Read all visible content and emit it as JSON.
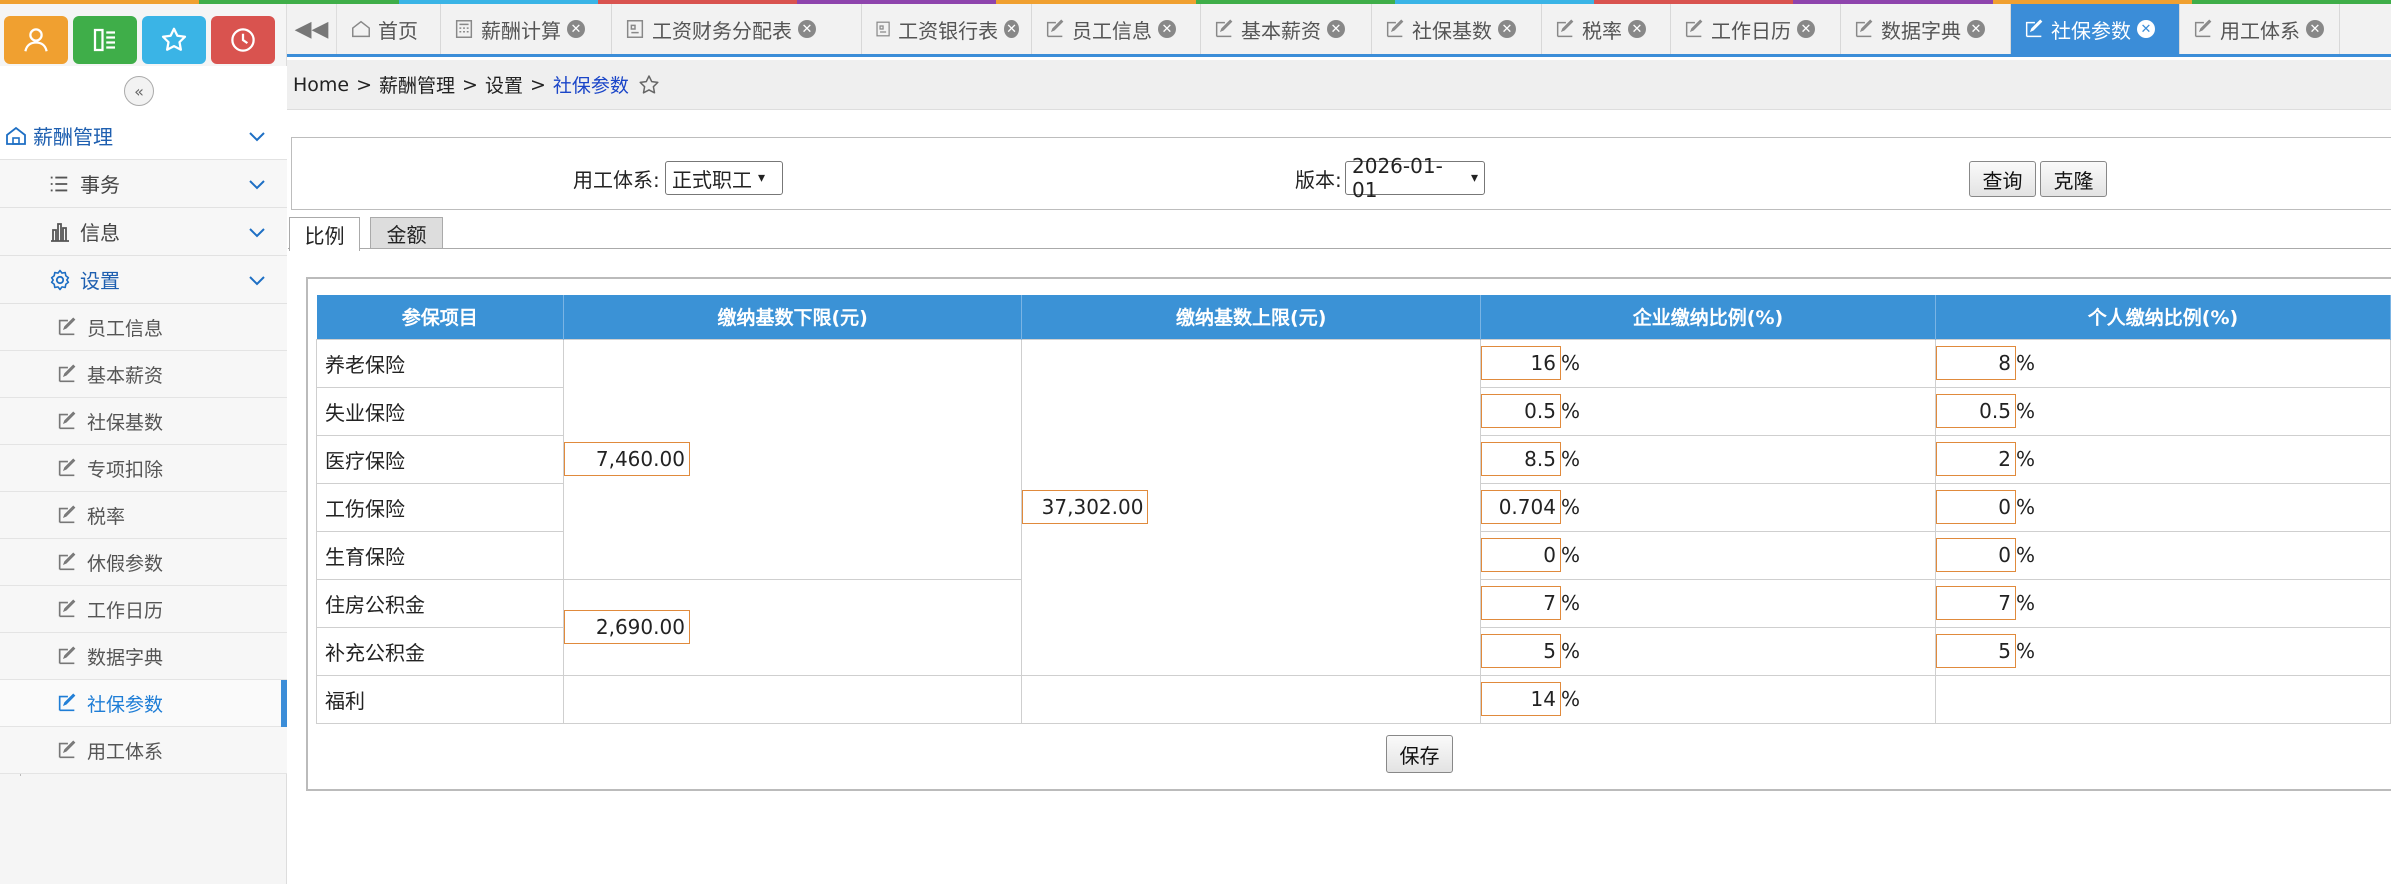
{
  "colors": {
    "accent": "#3b8dd8",
    "header_blue": "#3b92d6",
    "input_border": "#e08a3c",
    "quick_orange": "#f0a030",
    "quick_green": "#3fae49",
    "quick_cyan": "#3ab4e6",
    "quick_red": "#d9534f"
  },
  "quick_buttons": [
    {
      "icon": "user-icon"
    },
    {
      "icon": "list-icon"
    },
    {
      "icon": "star-icon"
    },
    {
      "icon": "clock-icon"
    }
  ],
  "sidebar": {
    "group": {
      "label": "薪酬管理",
      "icon": "home-icon"
    },
    "sections": [
      {
        "label": "事务",
        "icon": "list-icon"
      },
      {
        "label": "信息",
        "icon": "bar-chart-icon"
      },
      {
        "label": "设置",
        "icon": "gear-icon"
      }
    ],
    "items": [
      {
        "label": "员工信息"
      },
      {
        "label": "基本薪资"
      },
      {
        "label": "社保基数"
      },
      {
        "label": "专项扣除"
      },
      {
        "label": "税率"
      },
      {
        "label": "休假参数"
      },
      {
        "label": "工作日历"
      },
      {
        "label": "数据字典"
      },
      {
        "label": "社保参数",
        "active": true
      },
      {
        "label": "用工体系"
      }
    ]
  },
  "tabs": [
    {
      "label": "首页",
      "icon": "home-icon",
      "closable": false
    },
    {
      "label": "薪酬计算",
      "icon": "calculator-icon",
      "closable": true
    },
    {
      "label": "工资财务分配表",
      "icon": "report-icon",
      "closable": true
    },
    {
      "label": "工资银行表",
      "icon": "report-icon",
      "closable": true
    },
    {
      "label": "员工信息",
      "icon": "edit-icon",
      "closable": true
    },
    {
      "label": "基本薪资",
      "icon": "edit-icon",
      "closable": true
    },
    {
      "label": "社保基数",
      "icon": "edit-icon",
      "closable": true
    },
    {
      "label": "税率",
      "icon": "edit-icon",
      "closable": true
    },
    {
      "label": "工作日历",
      "icon": "edit-icon",
      "closable": true
    },
    {
      "label": "数据字典",
      "icon": "edit-icon",
      "closable": true
    },
    {
      "label": "社保参数",
      "icon": "edit-icon",
      "closable": true,
      "active": true
    },
    {
      "label": "用工体系",
      "icon": "edit-icon",
      "closable": true
    }
  ],
  "breadcrumb": {
    "home": "Home",
    "level1": "薪酬管理",
    "level2": "设置",
    "current": "社保参数",
    "sep": ">"
  },
  "query": {
    "system_label": "用工体系:",
    "system_value": "正式职工",
    "version_label": "版本:",
    "version_value": "2026-01-01",
    "query_button": "查询",
    "clone_button": "克隆"
  },
  "subtabs": [
    "比例",
    "金额"
  ],
  "table": {
    "headers": [
      "参保项目",
      "缴纳基数下限(元)",
      "缴纳基数上限(元)",
      "企业缴纳比例(%)",
      "个人缴纳比例(%)"
    ],
    "pct_sign": "%",
    "lower_base_main": "7,460.00",
    "lower_base_fund": "2,690.00",
    "upper_base": "37,302.00",
    "rows": [
      {
        "name": "养老保险",
        "company": "16",
        "personal": "8"
      },
      {
        "name": "失业保险",
        "company": "0.5",
        "personal": "0.5"
      },
      {
        "name": "医疗保险",
        "company": "8.5",
        "personal": "2"
      },
      {
        "name": "工伤保险",
        "company": "0.704",
        "personal": "0"
      },
      {
        "name": "生育保险",
        "company": "0",
        "personal": "0"
      },
      {
        "name": "住房公积金",
        "company": "7",
        "personal": "7"
      },
      {
        "name": "补充公积金",
        "company": "5",
        "personal": "5"
      },
      {
        "name": "福利",
        "company": "14",
        "personal": ""
      }
    ]
  },
  "save_button": "保存"
}
